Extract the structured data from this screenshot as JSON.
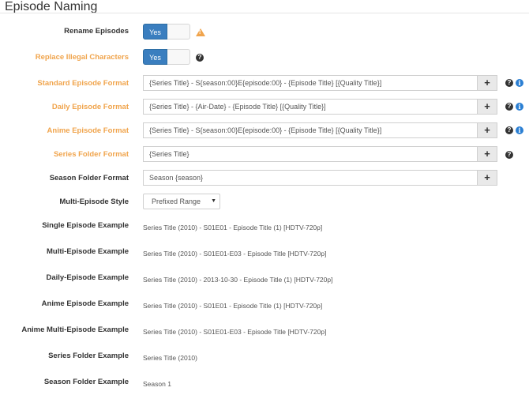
{
  "section": {
    "title": "Episode Naming"
  },
  "colors": {
    "accent_orange": "#f0a44c",
    "toggle_blue": "#3a7ebf",
    "info_blue": "#2b7fd3"
  },
  "fields": {
    "rename_episodes": {
      "label": "Rename Episodes",
      "value": "Yes"
    },
    "replace_illegal": {
      "label": "Replace Illegal Characters",
      "value": "Yes"
    },
    "standard_format": {
      "label": "Standard Episode Format",
      "value": "{Series Title} - S{season:00}E{episode:00} - {Episode Title} [{Quality Title}]"
    },
    "daily_format": {
      "label": "Daily Episode Format",
      "value": "{Series Title} - {Air-Date} - {Episode Title} [{Quality Title}]"
    },
    "anime_format": {
      "label": "Anime Episode Format",
      "value": "{Series Title} - S{season:00}E{episode:00} - {Episode Title} [{Quality Title}]"
    },
    "series_folder_format": {
      "label": "Series Folder Format",
      "value": "{Series Title}"
    },
    "season_folder_format": {
      "label": "Season Folder Format",
      "value": "Season {season}"
    },
    "multi_episode_style": {
      "label": "Multi-Episode Style",
      "value": "Prefixed Range"
    }
  },
  "examples": [
    {
      "label": "Single Episode Example",
      "value": "Series Title (2010) - S01E01 - Episode Title (1) [HDTV-720p]"
    },
    {
      "label": "Multi-Episode Example",
      "value": "Series Title (2010) - S01E01-E03 - Episode Title [HDTV-720p]"
    },
    {
      "label": "Daily-Episode Example",
      "value": "Series Title (2010) - 2013-10-30 - Episode Title (1) [HDTV-720p]"
    },
    {
      "label": "Anime Episode Example",
      "value": "Series Title (2010) - S01E01 - Episode Title (1) [HDTV-720p]"
    },
    {
      "label": "Anime Multi-Episode Example",
      "value": "Series Title (2010) - S01E01-E03 - Episode Title [HDTV-720p]"
    },
    {
      "label": "Series Folder Example",
      "value": "Series Title (2010)"
    },
    {
      "label": "Season Folder Example",
      "value": "Season 1"
    }
  ],
  "icons": {
    "plus": "+",
    "help": "?",
    "info": "i",
    "warning": "!",
    "caret": "▼"
  }
}
